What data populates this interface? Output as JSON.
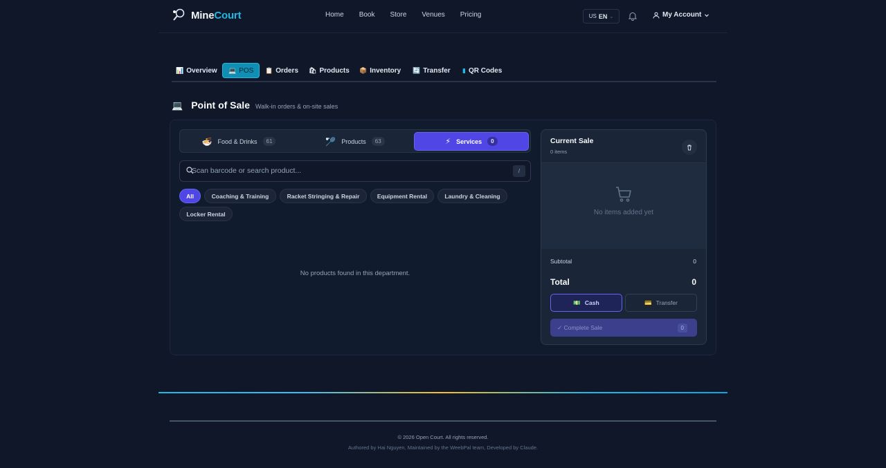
{
  "brand": {
    "name_part1": "Mine",
    "name_part2": "Court"
  },
  "nav": [
    "Home",
    "Book",
    "Store",
    "Venues",
    "Pricing"
  ],
  "lang": {
    "flag": "US",
    "code": "EN"
  },
  "account_label": "My Account",
  "tabs": [
    {
      "icon": "📊",
      "label": "Overview"
    },
    {
      "icon": "💻",
      "label": "POS"
    },
    {
      "icon": "📋",
      "label": "Orders"
    },
    {
      "icon": "🛍",
      "label": "Products"
    },
    {
      "icon": "📦",
      "label": "Inventory"
    },
    {
      "icon": "🔄",
      "label": "Transfer"
    },
    {
      "icon": "▮",
      "label": "QR Codes"
    }
  ],
  "page": {
    "icon": "💻",
    "title": "Point of Sale",
    "subtitle": "Walk-in orders & on-site sales"
  },
  "departments": [
    {
      "icon": "🍜",
      "label": "Food & Drinks",
      "count": "61"
    },
    {
      "icon": "🏸",
      "label": "Products",
      "count": "63"
    },
    {
      "icon": "⚡",
      "label": "Services",
      "count": "0"
    }
  ],
  "search": {
    "placeholder": "Scan barcode or search product...",
    "shortcut": "/"
  },
  "categories": [
    "All",
    "Coaching & Training",
    "Racket Stringing & Repair",
    "Equipment Rental",
    "Laundry & Cleaning",
    "Locker Rental"
  ],
  "empty_message": "No products found in this department.",
  "sale": {
    "title": "Current Sale",
    "items_count": "0 items",
    "empty": "No items added yet",
    "subtotal_label": "Subtotal",
    "subtotal_value": "0",
    "total_label": "Total",
    "total_value": "0",
    "cash_label": "Cash",
    "cash_icon": "💵",
    "transfer_label": "Transfer",
    "transfer_icon": "💳",
    "complete_label": "✓ Complete Sale",
    "complete_count": "0"
  },
  "footer": {
    "copyright": "© 2026 Open Court. All rights reserved.",
    "authors": "Authored by Hai Nguyen, Maintained by the WeebPal team, Developed by Claude."
  },
  "colors": {
    "accent": "#22b8e6",
    "primary": "#4f46e5",
    "background": "#0f1729"
  }
}
